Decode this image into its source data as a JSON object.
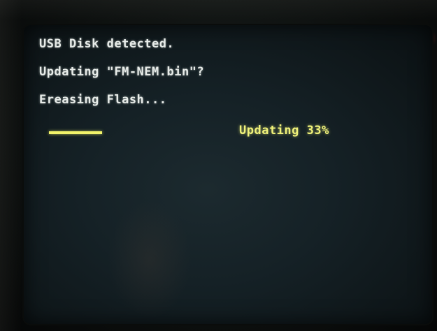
{
  "screen": {
    "lines": [
      "USB Disk detected.",
      "Updating \"FM-NEM.bin\"?",
      "Ereasing Flash..."
    ],
    "progress": {
      "fraction": 0.19
    },
    "status_label": "Updating",
    "status_percent": "33%"
  },
  "colors": {
    "text": "#e8ece9",
    "accent": "#f0f27a",
    "screen_bg": "#152126"
  }
}
